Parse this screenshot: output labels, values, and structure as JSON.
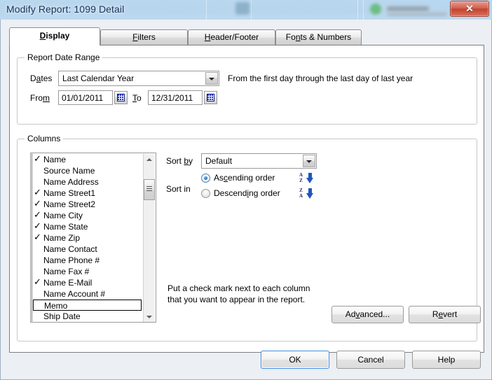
{
  "window": {
    "title": "Modify Report: 1099 Detail",
    "close_label": "✕"
  },
  "tabs": [
    {
      "label": "Display",
      "pre": "",
      "key": "D",
      "post": "isplay",
      "active": true
    },
    {
      "label": "Filters",
      "pre": "",
      "key": "F",
      "post": "ilters",
      "active": false
    },
    {
      "label": "Header/Footer",
      "pre": "",
      "key": "H",
      "post": "eader/Footer",
      "active": false
    },
    {
      "label": "Fonts & Numbers",
      "pre": "Fo",
      "key": "n",
      "post": "ts & Numbers",
      "active": false
    }
  ],
  "date_range": {
    "legend": "Report Date Range",
    "dates_label_pre": "D",
    "dates_label_key": "a",
    "dates_label_post": "tes",
    "dates_value": "Last Calendar Year",
    "from_label_pre": "Fro",
    "from_label_key": "m",
    "from_label_post": "",
    "from_value": "01/01/2011",
    "to_label_pre": "",
    "to_label_key": "T",
    "to_label_post": "o",
    "to_value": "12/31/2011",
    "description": "From the first day through the last day of last year",
    "calendar_icon": "calendar-icon"
  },
  "columns": {
    "legend": "Columns",
    "items": [
      {
        "label": "Name",
        "checked": true,
        "focused": false
      },
      {
        "label": "Source Name",
        "checked": false,
        "focused": false
      },
      {
        "label": "Name Address",
        "checked": false,
        "focused": false
      },
      {
        "label": "Name Street1",
        "checked": true,
        "focused": false
      },
      {
        "label": "Name Street2",
        "checked": true,
        "focused": false
      },
      {
        "label": "Name City",
        "checked": true,
        "focused": false
      },
      {
        "label": "Name State",
        "checked": true,
        "focused": false
      },
      {
        "label": "Name Zip",
        "checked": true,
        "focused": false
      },
      {
        "label": "Name Contact",
        "checked": false,
        "focused": false
      },
      {
        "label": "Name Phone #",
        "checked": false,
        "focused": false
      },
      {
        "label": "Name Fax #",
        "checked": false,
        "focused": false
      },
      {
        "label": "Name E-Mail",
        "checked": true,
        "focused": false
      },
      {
        "label": "Name Account #",
        "checked": false,
        "focused": false
      },
      {
        "label": "Memo",
        "checked": false,
        "focused": true
      },
      {
        "label": "Ship Date",
        "checked": false,
        "focused": false
      }
    ],
    "check_glyph": "✓",
    "sort_by_label_pre": "Sort ",
    "sort_by_label_key": "b",
    "sort_by_label_post": "y",
    "sort_by_value": "Default",
    "sort_in_label": "Sort in",
    "ascending_pre": "As",
    "ascending_key": "c",
    "ascending_post": "ending order",
    "ascending_selected": true,
    "ascending_icon_top": "A",
    "ascending_icon_bottom": "Z",
    "descending_pre": "Descend",
    "descending_key": "i",
    "descending_post": "ng order",
    "descending_selected": false,
    "descending_icon_top": "Z",
    "descending_icon_bottom": "A",
    "hint": "Put a check mark next to each column\nthat you want to appear in the report.",
    "advanced_pre": "Ad",
    "advanced_key": "v",
    "advanced_post": "anced...",
    "revert_pre": "R",
    "revert_key": "e",
    "revert_post": "vert"
  },
  "footer": {
    "ok_label": "OK",
    "cancel_label": "Cancel",
    "help_label": "Help"
  },
  "colors": {
    "titlebar_start": "#b9d7ee",
    "dialog_bg": "#eceff4",
    "accent_blue": "#1f55c0",
    "close_red": "#c1432f",
    "focus_blue": "#3c8dde"
  }
}
